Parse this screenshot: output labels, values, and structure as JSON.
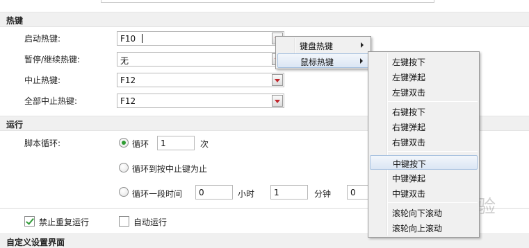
{
  "sections": {
    "hotkeys": "热键",
    "run": "运行",
    "custom_ui": "自定义设置界面"
  },
  "hotkeys": {
    "start": {
      "label": "启动热键:",
      "value": "F10"
    },
    "pause": {
      "label": "暂停/继续热键:",
      "value": "无"
    },
    "stop": {
      "label": "中止热键:",
      "value": "F12"
    },
    "stop_all": {
      "label": "全部中止热键:",
      "value": "F12"
    }
  },
  "run": {
    "loop_label": "脚本循环:",
    "loop_option": "循环",
    "loop_count": "1",
    "loop_unit": "次",
    "until_stop_option": "循环到按中止键为止",
    "timed_option": "循环一段时间",
    "hours_value": "0",
    "hours_unit": "小时",
    "minutes_value": "1",
    "minutes_unit": "分钟",
    "seconds_value": "0",
    "selected": "loop"
  },
  "options": {
    "no_repeat": {
      "label": "禁止重复运行",
      "checked": true
    },
    "auto_run": {
      "label": "自动运行",
      "checked": false
    }
  },
  "menu_main": {
    "items": [
      {
        "label": "键盘热键",
        "has_submenu": true
      },
      {
        "label": "鼠标热键",
        "has_submenu": true,
        "highlighted": true
      }
    ]
  },
  "menu_mouse": {
    "items": [
      "左键按下",
      "左键弹起",
      "左键双击",
      "右键按下",
      "右键弹起",
      "右键双击",
      "中键按下",
      "中键弹起",
      "中键双击",
      "滚轮向下滚动",
      "滚轮向上滚动"
    ],
    "highlighted_index": 6
  },
  "watermark": "经验",
  "colors": {
    "section_bg": "#f0f0f0",
    "accent_green": "#2e9c32",
    "caret_red": "#c0272d",
    "highlight_border": "#a8c2e0"
  }
}
